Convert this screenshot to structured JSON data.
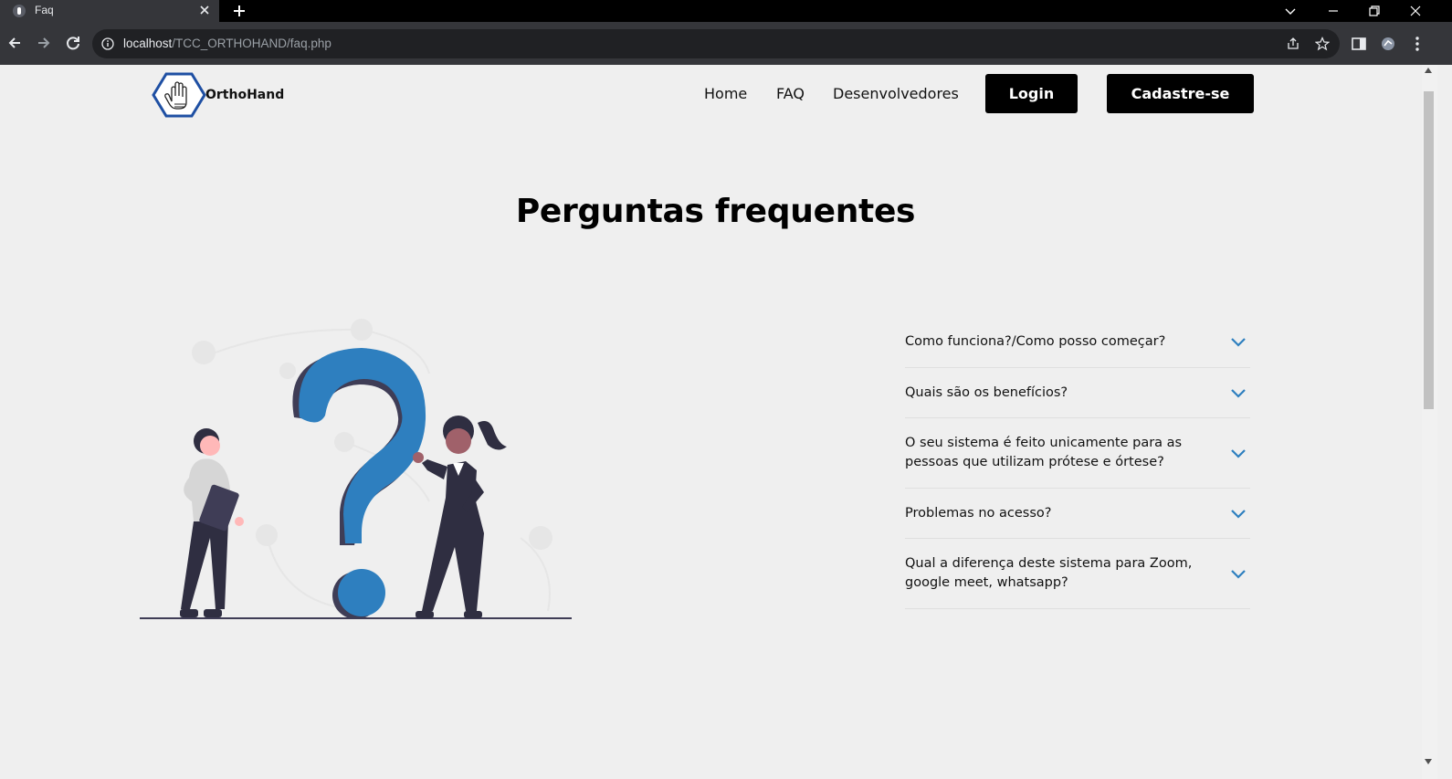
{
  "browser": {
    "tab_title": "Faq",
    "url_host": "localhost",
    "url_path": "/TCC_ORTHOHAND/faq.php"
  },
  "header": {
    "logo_text": "OrthoHand",
    "nav": [
      "Home",
      "FAQ",
      "Desenvolvedores"
    ],
    "login_label": "Login",
    "signup_label": "Cadastre-se"
  },
  "page_title": "Perguntas frequentes",
  "faq": [
    "Como funciona?/Como posso começar?",
    "Quais são os benefícios?",
    "O seu sistema é feito unicamente para as pessoas que utilizam prótese e órtese?",
    "Problemas no acesso?",
    "Qual a diferença deste sistema para Zoom, google meet, whatsapp?"
  ],
  "colors": {
    "accent": "#2e7fbf",
    "chevron": "#2e7fbf",
    "button_bg": "#000000",
    "page_bg": "#efefef"
  },
  "icons": [
    "info-icon",
    "back-icon",
    "forward-icon",
    "reload-icon",
    "share-icon",
    "star-icon",
    "sidebar-icon",
    "extension-icon",
    "menu-icon",
    "chevron-down-icon"
  ]
}
